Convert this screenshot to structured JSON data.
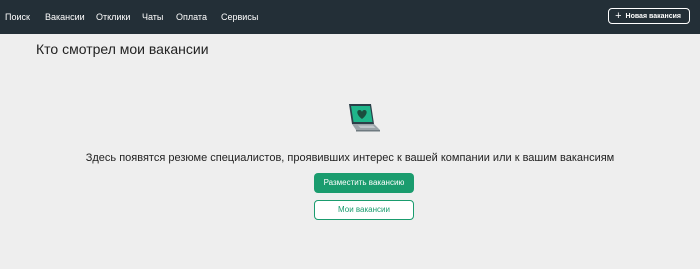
{
  "nav": {
    "items": [
      {
        "label": "Поиск"
      },
      {
        "label": "Вакансии"
      },
      {
        "label": "Отклики"
      },
      {
        "label": "Чаты"
      },
      {
        "label": "Оплата"
      },
      {
        "label": "Сервисы"
      }
    ],
    "new_vacancy_label": "Новая вакансия"
  },
  "page": {
    "title": "Кто смотрел мои вакансии",
    "empty_message": "Здесь появятся резюме специалистов, проявивших интерес к вашей компании или к вашим вакансиям",
    "primary_button": "Разместить вакансию",
    "secondary_button": "Мои вакансии"
  },
  "colors": {
    "header_bg": "#232f37",
    "accent": "#1a9c6e",
    "page_bg": "#eeeeee"
  },
  "icons": {
    "plus": "plus-icon",
    "illustration": "laptop-heart-icon"
  }
}
